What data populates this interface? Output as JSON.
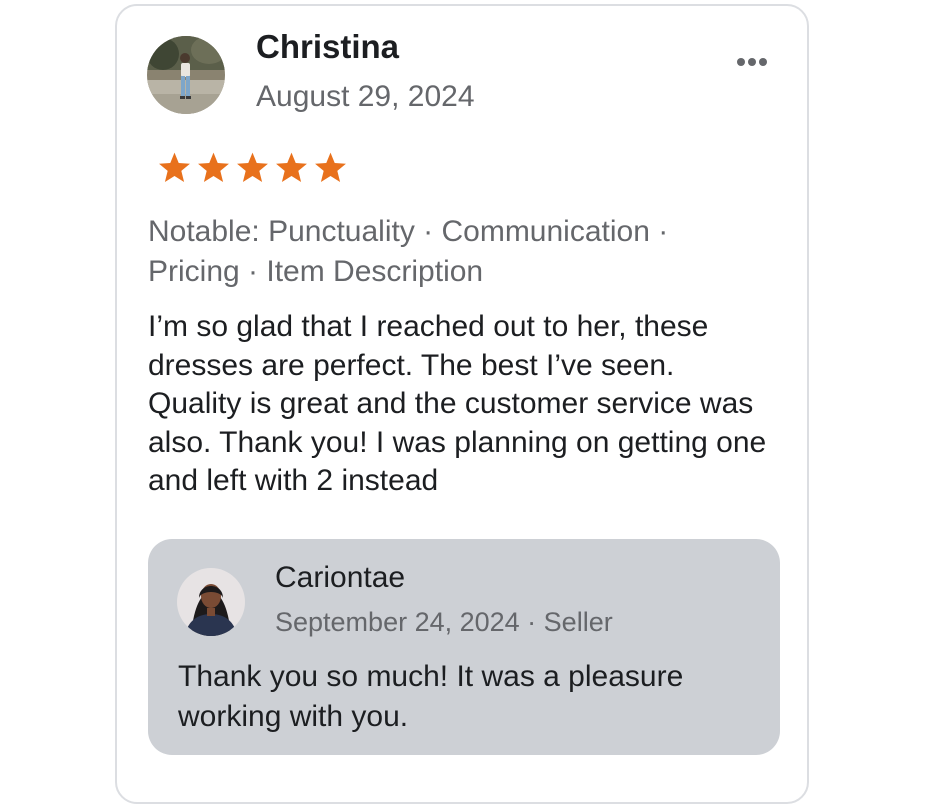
{
  "review": {
    "reviewer_name": "Christina",
    "date": "August 29, 2024",
    "rating": 5,
    "rating_max": 5,
    "star_color": "#e8711c",
    "notable": "Notable: Punctuality · Communication · Pricing · Item Description",
    "text": "I’m so glad that I reached out to her, these dresses are perfect. The best I’ve seen. Quality is great and the customer service was also. Thank you! I was planning on getting one and left with 2 instead",
    "more_icon": "more-horizontal-icon"
  },
  "reply": {
    "name": "Cariontae",
    "meta": "September 24, 2024 · Seller",
    "text": "Thank you so much! It was a pleasure working with you."
  }
}
